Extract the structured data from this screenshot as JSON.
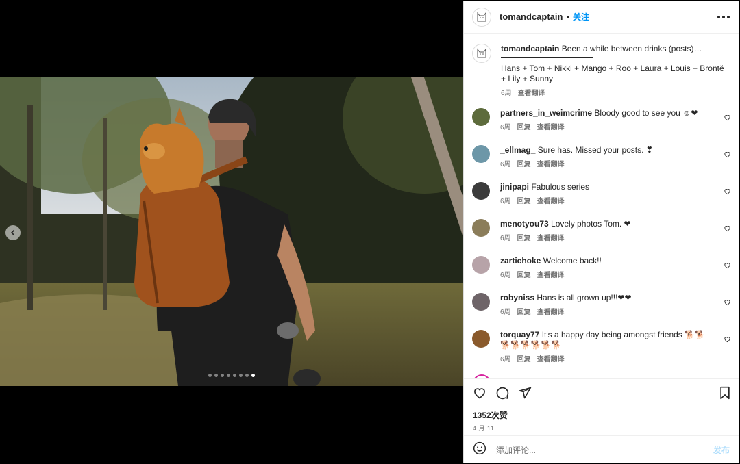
{
  "post": {
    "username": "tomandcaptain",
    "separator": "•",
    "follow_label": "关注",
    "photo_dots": 8,
    "active_dot": 7
  },
  "caption": {
    "username": "tomandcaptain",
    "line1": "Been a while between drinks (posts)…",
    "line2": "Hans + Tom + Nikki + Mango + Roo + Laura + Louis + Brontë + Lily + Sunny",
    "time": "6周",
    "translate": "查看翻译"
  },
  "comments": [
    {
      "username": "partners_in_weimcrime",
      "text": "Bloody good to see you ☺❤",
      "time": "6周",
      "reply": "回复",
      "translate": "查看翻译",
      "avatar_color": "#5d6b3c"
    },
    {
      "username": "_ellmag_",
      "text": "Sure has. Missed your posts. ❣",
      "time": "6周",
      "reply": "回复",
      "translate": "查看翻译",
      "avatar_color": "#6d97a8"
    },
    {
      "username": "jinipapi",
      "text": "Fabulous series",
      "time": "6周",
      "reply": "回复",
      "translate": "查看翻译",
      "avatar_color": "#3c3c3c"
    },
    {
      "username": "menotyou73",
      "text": "Lovely photos Tom. ❤",
      "time": "6周",
      "reply": "回复",
      "translate": "查看翻译",
      "avatar_color": "#8b7d5a"
    },
    {
      "username": "zartichoke",
      "text": "Welcome back!!",
      "time": "6周",
      "reply": "回复",
      "translate": "查看翻译",
      "avatar_color": "#b7a3a8"
    },
    {
      "username": "robyniss",
      "text": "Hans is all grown up!!!❤❤",
      "time": "6周",
      "reply": "回复",
      "translate": "查看翻译",
      "avatar_color": "#6e6468"
    },
    {
      "username": "torquay77",
      "text": "It's a happy day being amongst friends 🐕🐕🐕🐕🐕🐕🐕🐕",
      "time": "6周",
      "reply": "回复",
      "translate": "查看翻译",
      "avatar_color": "#8a5a2c"
    }
  ],
  "actions": {
    "likes": "1352次赞",
    "date": "4 月 11"
  },
  "add_comment": {
    "placeholder": "添加评论...",
    "post_label": "发布"
  },
  "colors": {
    "accent": "#0095f6",
    "post_disabled": "#b2dffc",
    "text": "#262626",
    "secondary": "#737373"
  }
}
